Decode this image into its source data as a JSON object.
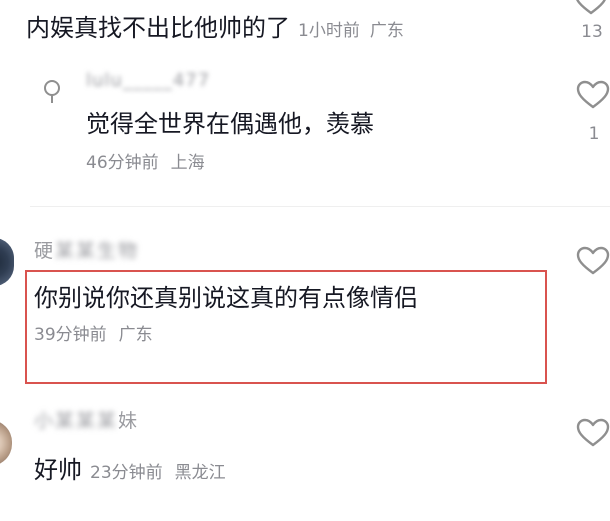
{
  "comments": [
    {
      "text": "内娱真找不出比他帅的了",
      "time": "1小时前",
      "location": "广东",
      "likes": "13"
    },
    {
      "text": "你别说你还真别说这真的有点像情侣",
      "time": "39分钟前",
      "location": "广东",
      "username_visible": "硬",
      "username_blurred": "某某生物",
      "highlighted": true
    },
    {
      "text": "好帅",
      "time": "23分钟前",
      "location": "黑龙江",
      "username_visible": "妹",
      "username_blurred": "小某某某"
    }
  ],
  "reply": {
    "username_blurred": "lulu_____477",
    "text": "觉得全世界在偶遇他，羡慕",
    "time": "46分钟前",
    "location": "上海",
    "likes": "1"
  },
  "colors": {
    "text": "#161823",
    "meta": "#8a8b91",
    "highlight_border": "#d9534f",
    "heart_stroke": "#8f8f8f"
  },
  "icons": [
    "heart-outline-icon",
    "reply-avatar-icon"
  ]
}
